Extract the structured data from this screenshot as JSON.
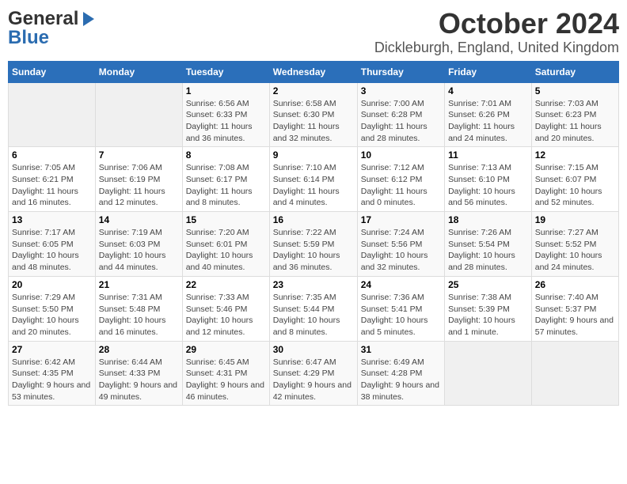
{
  "logo": {
    "line1": "General",
    "line2": "Blue"
  },
  "title": "October 2024",
  "subtitle": "Dickleburgh, England, United Kingdom",
  "days_of_week": [
    "Sunday",
    "Monday",
    "Tuesday",
    "Wednesday",
    "Thursday",
    "Friday",
    "Saturday"
  ],
  "weeks": [
    [
      {
        "day": "",
        "info": ""
      },
      {
        "day": "",
        "info": ""
      },
      {
        "day": "1",
        "info": "Sunrise: 6:56 AM\nSunset: 6:33 PM\nDaylight: 11 hours and 36 minutes."
      },
      {
        "day": "2",
        "info": "Sunrise: 6:58 AM\nSunset: 6:30 PM\nDaylight: 11 hours and 32 minutes."
      },
      {
        "day": "3",
        "info": "Sunrise: 7:00 AM\nSunset: 6:28 PM\nDaylight: 11 hours and 28 minutes."
      },
      {
        "day": "4",
        "info": "Sunrise: 7:01 AM\nSunset: 6:26 PM\nDaylight: 11 hours and 24 minutes."
      },
      {
        "day": "5",
        "info": "Sunrise: 7:03 AM\nSunset: 6:23 PM\nDaylight: 11 hours and 20 minutes."
      }
    ],
    [
      {
        "day": "6",
        "info": "Sunrise: 7:05 AM\nSunset: 6:21 PM\nDaylight: 11 hours and 16 minutes."
      },
      {
        "day": "7",
        "info": "Sunrise: 7:06 AM\nSunset: 6:19 PM\nDaylight: 11 hours and 12 minutes."
      },
      {
        "day": "8",
        "info": "Sunrise: 7:08 AM\nSunset: 6:17 PM\nDaylight: 11 hours and 8 minutes."
      },
      {
        "day": "9",
        "info": "Sunrise: 7:10 AM\nSunset: 6:14 PM\nDaylight: 11 hours and 4 minutes."
      },
      {
        "day": "10",
        "info": "Sunrise: 7:12 AM\nSunset: 6:12 PM\nDaylight: 11 hours and 0 minutes."
      },
      {
        "day": "11",
        "info": "Sunrise: 7:13 AM\nSunset: 6:10 PM\nDaylight: 10 hours and 56 minutes."
      },
      {
        "day": "12",
        "info": "Sunrise: 7:15 AM\nSunset: 6:07 PM\nDaylight: 10 hours and 52 minutes."
      }
    ],
    [
      {
        "day": "13",
        "info": "Sunrise: 7:17 AM\nSunset: 6:05 PM\nDaylight: 10 hours and 48 minutes."
      },
      {
        "day": "14",
        "info": "Sunrise: 7:19 AM\nSunset: 6:03 PM\nDaylight: 10 hours and 44 minutes."
      },
      {
        "day": "15",
        "info": "Sunrise: 7:20 AM\nSunset: 6:01 PM\nDaylight: 10 hours and 40 minutes."
      },
      {
        "day": "16",
        "info": "Sunrise: 7:22 AM\nSunset: 5:59 PM\nDaylight: 10 hours and 36 minutes."
      },
      {
        "day": "17",
        "info": "Sunrise: 7:24 AM\nSunset: 5:56 PM\nDaylight: 10 hours and 32 minutes."
      },
      {
        "day": "18",
        "info": "Sunrise: 7:26 AM\nSunset: 5:54 PM\nDaylight: 10 hours and 28 minutes."
      },
      {
        "day": "19",
        "info": "Sunrise: 7:27 AM\nSunset: 5:52 PM\nDaylight: 10 hours and 24 minutes."
      }
    ],
    [
      {
        "day": "20",
        "info": "Sunrise: 7:29 AM\nSunset: 5:50 PM\nDaylight: 10 hours and 20 minutes."
      },
      {
        "day": "21",
        "info": "Sunrise: 7:31 AM\nSunset: 5:48 PM\nDaylight: 10 hours and 16 minutes."
      },
      {
        "day": "22",
        "info": "Sunrise: 7:33 AM\nSunset: 5:46 PM\nDaylight: 10 hours and 12 minutes."
      },
      {
        "day": "23",
        "info": "Sunrise: 7:35 AM\nSunset: 5:44 PM\nDaylight: 10 hours and 8 minutes."
      },
      {
        "day": "24",
        "info": "Sunrise: 7:36 AM\nSunset: 5:41 PM\nDaylight: 10 hours and 5 minutes."
      },
      {
        "day": "25",
        "info": "Sunrise: 7:38 AM\nSunset: 5:39 PM\nDaylight: 10 hours and 1 minute."
      },
      {
        "day": "26",
        "info": "Sunrise: 7:40 AM\nSunset: 5:37 PM\nDaylight: 9 hours and 57 minutes."
      }
    ],
    [
      {
        "day": "27",
        "info": "Sunrise: 6:42 AM\nSunset: 4:35 PM\nDaylight: 9 hours and 53 minutes."
      },
      {
        "day": "28",
        "info": "Sunrise: 6:44 AM\nSunset: 4:33 PM\nDaylight: 9 hours and 49 minutes."
      },
      {
        "day": "29",
        "info": "Sunrise: 6:45 AM\nSunset: 4:31 PM\nDaylight: 9 hours and 46 minutes."
      },
      {
        "day": "30",
        "info": "Sunrise: 6:47 AM\nSunset: 4:29 PM\nDaylight: 9 hours and 42 minutes."
      },
      {
        "day": "31",
        "info": "Sunrise: 6:49 AM\nSunset: 4:28 PM\nDaylight: 9 hours and 38 minutes."
      },
      {
        "day": "",
        "info": ""
      },
      {
        "day": "",
        "info": ""
      }
    ]
  ]
}
